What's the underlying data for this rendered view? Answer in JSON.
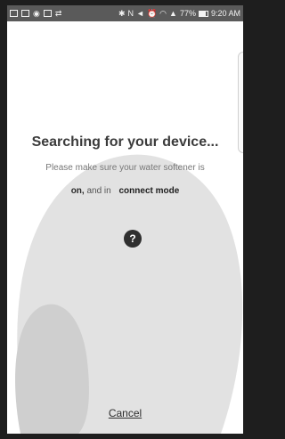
{
  "status_bar": {
    "battery_text": "77%",
    "time": "9:20 AM"
  },
  "main": {
    "title": "Searching for your device...",
    "subtitle": "Please make sure your water softener is",
    "line2_on": "on,",
    "line2_mid": " and in ",
    "line2_mode": "connect mode",
    "help_symbol": "?",
    "cancel_label": "Cancel"
  },
  "colors": {
    "blob_light": "#e2e2e2",
    "blob_dark": "#cfcfcf",
    "help_bg": "#2f2f2f"
  },
  "icons": {
    "status_left": [
      "mail-icon",
      "gallery-icon",
      "notification-icon",
      "photo-icon",
      "wifi-direct-icon"
    ],
    "status_right": [
      "bluetooth-icon",
      "nfc-icon",
      "mute-icon",
      "alarm-icon",
      "wifi-icon",
      "signal-icon",
      "battery-icon"
    ]
  }
}
